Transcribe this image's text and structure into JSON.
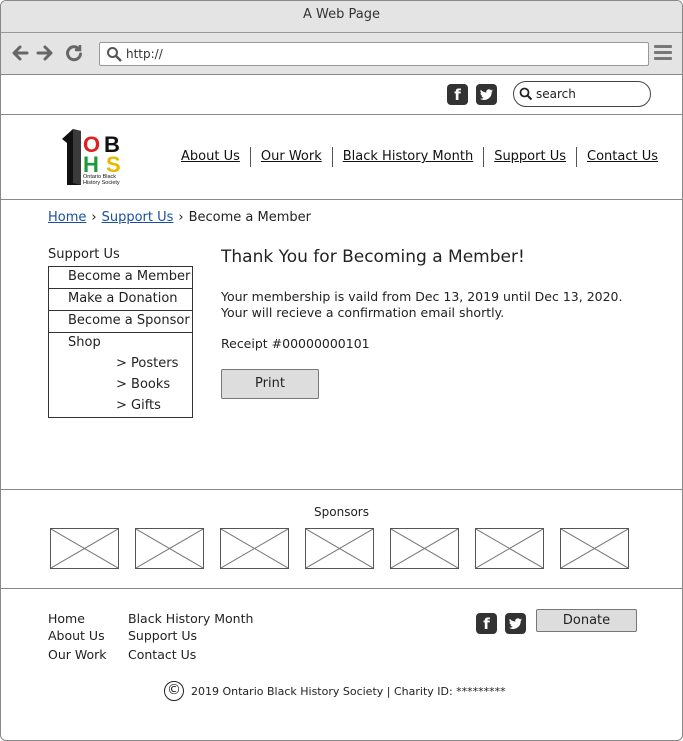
{
  "browser": {
    "title": "A Web Page",
    "url": "http://"
  },
  "topbar": {
    "search_placeholder": "search"
  },
  "nav": {
    "items": [
      "About Us",
      "Our Work",
      "Black History Month",
      "Support Us",
      "Contact Us"
    ]
  },
  "logo": {
    "letters_top": "OB",
    "letters_bottom": "HS",
    "caption": "Ontario Black History Society"
  },
  "breadcrumb": {
    "home": "Home",
    "support": "Support Us",
    "current": "Become a Member"
  },
  "sidebar": {
    "heading": "Support Us",
    "items": [
      "Become a Member",
      "Make a Donation",
      "Become a Sponsor"
    ],
    "shop": "Shop",
    "shop_items": [
      "> Posters",
      "> Books",
      "> Gifts"
    ]
  },
  "content": {
    "title": "Thank You for Becoming a Member!",
    "line1": "Your membership is vaild from Dec 13, 2019 until Dec 13, 2020.",
    "line2": "Your will recieve a confirmation email shortly.",
    "receipt": "Receipt #00000000101",
    "print": "Print"
  },
  "sponsors": {
    "title": "Sponsors"
  },
  "footer": {
    "col1": [
      "Home",
      "About Us",
      "Our Work"
    ],
    "col2": [
      "Black History Month",
      "Support Us",
      "Contact Us"
    ],
    "donate": "Donate",
    "copyright": "2019 Ontario Black History Society | Charity ID: *********"
  },
  "colors": {
    "link": "#1a4fa0",
    "button_bg": "#dddddd"
  }
}
